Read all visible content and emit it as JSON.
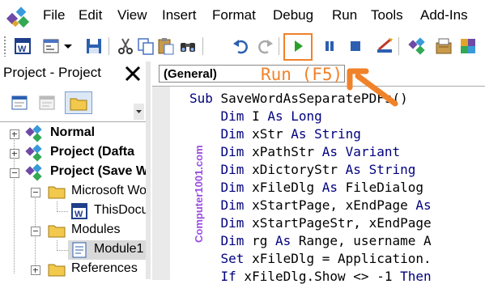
{
  "menu": {
    "items": [
      {
        "label": "File"
      },
      {
        "label": "Edit"
      },
      {
        "label": "View"
      },
      {
        "label": "Insert"
      },
      {
        "label": "Format"
      },
      {
        "label": "Debug"
      },
      {
        "label": "Run"
      },
      {
        "label": "Tools"
      },
      {
        "label": "Add-Ins"
      }
    ]
  },
  "toolbar": {
    "icons": [
      "word-icon",
      "userform-icon",
      "dropdown-arrow-icon",
      "save-icon",
      "cut-icon",
      "copy-icon",
      "paste-icon",
      "find-icon",
      "undo-icon",
      "redo-icon",
      "run-icon",
      "break-icon",
      "reset-icon",
      "design-mode-icon",
      "project-explorer-icon",
      "properties-icon",
      "object-browser-icon"
    ],
    "run_highlight_color": "#f0822a"
  },
  "annotation": {
    "run_label": "Run (F5)",
    "arrow_color": "#f0822a"
  },
  "project_panel": {
    "title": "Project - Project",
    "tree": [
      {
        "label": "Normal",
        "bold": true
      },
      {
        "label": "Project (Dafta",
        "bold": true
      },
      {
        "label": "Project (Save W",
        "bold": true
      },
      {
        "label": "Microsoft Wo",
        "bold": false
      },
      {
        "label": "ThisDocu",
        "bold": false
      },
      {
        "label": "Modules",
        "bold": false
      },
      {
        "label": "Module1",
        "bold": false
      },
      {
        "label": "References",
        "bold": false
      }
    ]
  },
  "code_editor": {
    "object_combo": "(General)",
    "watermark": "Computer1001.com",
    "keyword_color": "#00007f",
    "lines": [
      [
        {
          "k": "Sub"
        },
        {
          "t": " SaveWordAsSeparatePDFs()"
        }
      ],
      [
        {
          "t": "    "
        },
        {
          "k": "Dim"
        },
        {
          "t": " I "
        },
        {
          "k": "As"
        },
        {
          "t": " "
        },
        {
          "k": "Long"
        }
      ],
      [
        {
          "t": "    "
        },
        {
          "k": "Dim"
        },
        {
          "t": " xStr "
        },
        {
          "k": "As"
        },
        {
          "t": " "
        },
        {
          "k": "String"
        }
      ],
      [
        {
          "t": "    "
        },
        {
          "k": "Dim"
        },
        {
          "t": " xPathStr "
        },
        {
          "k": "As"
        },
        {
          "t": " "
        },
        {
          "k": "Variant"
        }
      ],
      [
        {
          "t": "    "
        },
        {
          "k": "Dim"
        },
        {
          "t": " xDictoryStr "
        },
        {
          "k": "As"
        },
        {
          "t": " "
        },
        {
          "k": "String"
        }
      ],
      [
        {
          "t": "    "
        },
        {
          "k": "Dim"
        },
        {
          "t": " xFileDlg "
        },
        {
          "k": "As"
        },
        {
          "t": " FileDialog"
        }
      ],
      [
        {
          "t": "    "
        },
        {
          "k": "Dim"
        },
        {
          "t": " xStartPage, xEndPage "
        },
        {
          "k": "As"
        }
      ],
      [
        {
          "t": "    "
        },
        {
          "k": "Dim"
        },
        {
          "t": " xStartPageStr, xEndPage"
        }
      ],
      [
        {
          "t": "    "
        },
        {
          "k": "Dim"
        },
        {
          "t": " rg "
        },
        {
          "k": "As"
        },
        {
          "t": " Range, username A"
        }
      ],
      [
        {
          "t": "    "
        },
        {
          "k": "Set"
        },
        {
          "t": " xFileDlg = Application."
        }
      ],
      [
        {
          "t": "    "
        },
        {
          "k": "If"
        },
        {
          "t": " xFileDlg.Show <> -1 "
        },
        {
          "k": "Then"
        }
      ]
    ]
  }
}
